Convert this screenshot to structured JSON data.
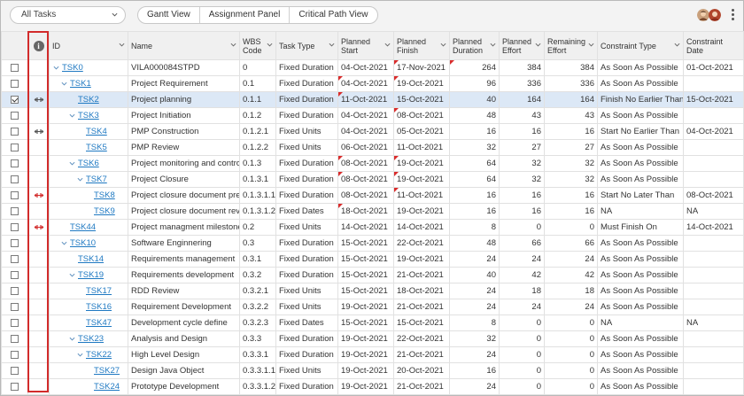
{
  "toolbar": {
    "filter": "All Tasks",
    "views": [
      "Gantt View",
      "Assignment Panel",
      "Critical Path View"
    ],
    "more_icon": "kebab-menu-icon"
  },
  "columns": [
    "ID",
    "Name",
    "WBS Code",
    "Task Type",
    "Planned Start",
    "Planned Finish",
    "Planned Duration",
    "Planned Effort",
    "Remaining Effort",
    "Constraint Type",
    "Constraint Date"
  ],
  "column_lines": {
    "wbs": [
      "WBS",
      "Code"
    ],
    "start": [
      "Planned",
      "Start"
    ],
    "finish": [
      "Planned",
      "Finish"
    ],
    "duration": [
      "Planned",
      "Duration"
    ],
    "effort": [
      "Planned",
      "Effort"
    ],
    "remaining": [
      "Remaining",
      "Effort"
    ],
    "cdate": [
      "Constraint",
      "Date"
    ]
  },
  "rows": [
    {
      "id": "TSK0",
      "name": "VILA000084STPD",
      "wbs": "0",
      "type": "Fixed Duration",
      "start": "04-Oct-2021",
      "finish": "17-Nov-2021",
      "duration": "264",
      "effort": "384",
      "remaining": "384",
      "ctype": "As Soon As Possible",
      "cdate": "01-Oct-2021",
      "level": 0,
      "expand": true,
      "indicator": "",
      "selected": false
    },
    {
      "id": "TSK1",
      "name": "Project Requirement",
      "wbs": "0.1",
      "type": "Fixed Duration",
      "start": "04-Oct-2021",
      "finish": "19-Oct-2021",
      "duration": "96",
      "effort": "336",
      "remaining": "336",
      "ctype": "As Soon As Possible",
      "cdate": "",
      "level": 1,
      "expand": true,
      "indicator": "",
      "selected": false
    },
    {
      "id": "TSK2",
      "name": "Project planning",
      "wbs": "0.1.1",
      "type": "Fixed Duration",
      "start": "11-Oct-2021",
      "finish": "15-Oct-2021",
      "duration": "40",
      "effort": "164",
      "remaining": "164",
      "ctype": "Finish No Earlier Than",
      "cdate": "15-Oct-2021",
      "level": 2,
      "expand": false,
      "indicator": "constraint-icon",
      "selected": true
    },
    {
      "id": "TSK3",
      "name": "Project Initiation",
      "wbs": "0.1.2",
      "type": "Fixed Duration",
      "start": "04-Oct-2021",
      "finish": "08-Oct-2021",
      "duration": "48",
      "effort": "43",
      "remaining": "43",
      "ctype": "As Soon As Possible",
      "cdate": "",
      "level": 2,
      "expand": true,
      "indicator": "",
      "selected": false
    },
    {
      "id": "TSK4",
      "name": "PMP Construction",
      "wbs": "0.1.2.1",
      "type": "Fixed Units",
      "start": "04-Oct-2021",
      "finish": "05-Oct-2021",
      "duration": "16",
      "effort": "16",
      "remaining": "16",
      "ctype": "Start No Earlier Than",
      "cdate": "04-Oct-2021",
      "level": 3,
      "expand": false,
      "indicator": "constraint-icon",
      "selected": false
    },
    {
      "id": "TSK5",
      "name": "PMP Review",
      "wbs": "0.1.2.2",
      "type": "Fixed Units",
      "start": "06-Oct-2021",
      "finish": "11-Oct-2021",
      "duration": "32",
      "effort": "27",
      "remaining": "27",
      "ctype": "As Soon As Possible",
      "cdate": "",
      "level": 3,
      "expand": false,
      "indicator": "",
      "selected": false
    },
    {
      "id": "TSK6",
      "name": "Project monitoring and control",
      "wbs": "0.1.3",
      "type": "Fixed Duration",
      "start": "08-Oct-2021",
      "finish": "19-Oct-2021",
      "duration": "64",
      "effort": "32",
      "remaining": "32",
      "ctype": "As Soon As Possible",
      "cdate": "",
      "level": 2,
      "expand": true,
      "indicator": "",
      "selected": false
    },
    {
      "id": "TSK7",
      "name": "Project Closure",
      "wbs": "0.1.3.1",
      "type": "Fixed Duration",
      "start": "08-Oct-2021",
      "finish": "19-Oct-2021",
      "duration": "64",
      "effort": "32",
      "remaining": "32",
      "ctype": "As Soon As Possible",
      "cdate": "",
      "level": 3,
      "expand": true,
      "indicator": "",
      "selected": false
    },
    {
      "id": "TSK8",
      "name": "Project closure document prepa",
      "wbs": "0.1.3.1.1",
      "type": "Fixed Duration",
      "start": "08-Oct-2021",
      "finish": "11-Oct-2021",
      "duration": "16",
      "effort": "16",
      "remaining": "16",
      "ctype": "Start No Later Than",
      "cdate": "08-Oct-2021",
      "level": 4,
      "expand": false,
      "indicator": "constraint-alert-icon",
      "selected": false
    },
    {
      "id": "TSK9",
      "name": "Project closure document reviev",
      "wbs": "0.1.3.1.2",
      "type": "Fixed Dates",
      "start": "18-Oct-2021",
      "finish": "19-Oct-2021",
      "duration": "16",
      "effort": "16",
      "remaining": "16",
      "ctype": "NA",
      "cdate": "NA",
      "level": 4,
      "expand": false,
      "indicator": "",
      "selected": false
    },
    {
      "id": "TSK44",
      "name": "Project managment milestone",
      "wbs": "0.2",
      "type": "Fixed Units",
      "start": "14-Oct-2021",
      "finish": "14-Oct-2021",
      "duration": "8",
      "effort": "0",
      "remaining": "0",
      "ctype": "Must Finish On",
      "cdate": "14-Oct-2021",
      "level": 1,
      "expand": false,
      "indicator": "constraint-alert-icon",
      "selected": false
    },
    {
      "id": "TSK10",
      "name": "Software Enginnering",
      "wbs": "0.3",
      "type": "Fixed Duration",
      "start": "15-Oct-2021",
      "finish": "22-Oct-2021",
      "duration": "48",
      "effort": "66",
      "remaining": "66",
      "ctype": "As Soon As Possible",
      "cdate": "",
      "level": 1,
      "expand": true,
      "indicator": "",
      "selected": false
    },
    {
      "id": "TSK14",
      "name": "Requirements management",
      "wbs": "0.3.1",
      "type": "Fixed Duration",
      "start": "15-Oct-2021",
      "finish": "19-Oct-2021",
      "duration": "24",
      "effort": "24",
      "remaining": "24",
      "ctype": "As Soon As Possible",
      "cdate": "",
      "level": 2,
      "expand": false,
      "indicator": "",
      "selected": false
    },
    {
      "id": "TSK19",
      "name": "Requirements development",
      "wbs": "0.3.2",
      "type": "Fixed Duration",
      "start": "15-Oct-2021",
      "finish": "21-Oct-2021",
      "duration": "40",
      "effort": "42",
      "remaining": "42",
      "ctype": "As Soon As Possible",
      "cdate": "",
      "level": 2,
      "expand": true,
      "indicator": "",
      "selected": false
    },
    {
      "id": "TSK17",
      "name": "RDD Review",
      "wbs": "0.3.2.1",
      "type": "Fixed Units",
      "start": "15-Oct-2021",
      "finish": "18-Oct-2021",
      "duration": "24",
      "effort": "18",
      "remaining": "18",
      "ctype": "As Soon As Possible",
      "cdate": "",
      "level": 3,
      "expand": false,
      "indicator": "",
      "selected": false
    },
    {
      "id": "TSK16",
      "name": "Requirement Development",
      "wbs": "0.3.2.2",
      "type": "Fixed Units",
      "start": "19-Oct-2021",
      "finish": "21-Oct-2021",
      "duration": "24",
      "effort": "24",
      "remaining": "24",
      "ctype": "As Soon As Possible",
      "cdate": "",
      "level": 3,
      "expand": false,
      "indicator": "",
      "selected": false
    },
    {
      "id": "TSK47",
      "name": "Development cycle define",
      "wbs": "0.3.2.3",
      "type": "Fixed Dates",
      "start": "15-Oct-2021",
      "finish": "15-Oct-2021",
      "duration": "8",
      "effort": "0",
      "remaining": "0",
      "ctype": "NA",
      "cdate": "NA",
      "level": 3,
      "expand": false,
      "indicator": "",
      "selected": false
    },
    {
      "id": "TSK23",
      "name": "Analysis and Design",
      "wbs": "0.3.3",
      "type": "Fixed Duration",
      "start": "19-Oct-2021",
      "finish": "22-Oct-2021",
      "duration": "32",
      "effort": "0",
      "remaining": "0",
      "ctype": "As Soon As Possible",
      "cdate": "",
      "level": 2,
      "expand": true,
      "indicator": "",
      "selected": false
    },
    {
      "id": "TSK22",
      "name": "High Level Design",
      "wbs": "0.3.3.1",
      "type": "Fixed Duration",
      "start": "19-Oct-2021",
      "finish": "21-Oct-2021",
      "duration": "24",
      "effort": "0",
      "remaining": "0",
      "ctype": "As Soon As Possible",
      "cdate": "",
      "level": 3,
      "expand": true,
      "indicator": "",
      "selected": false
    },
    {
      "id": "TSK27",
      "name": "Design Java Object",
      "wbs": "0.3.3.1.1",
      "type": "Fixed Units",
      "start": "19-Oct-2021",
      "finish": "20-Oct-2021",
      "duration": "16",
      "effort": "0",
      "remaining": "0",
      "ctype": "As Soon As Possible",
      "cdate": "",
      "level": 4,
      "expand": false,
      "indicator": "",
      "selected": false
    },
    {
      "id": "TSK24",
      "name": "Prototype Development",
      "wbs": "0.3.3.1.2",
      "type": "Fixed Duration",
      "start": "19-Oct-2021",
      "finish": "21-Oct-2021",
      "duration": "24",
      "effort": "0",
      "remaining": "0",
      "ctype": "As Soon As Possible",
      "cdate": "",
      "level": 4,
      "expand": false,
      "indicator": "",
      "selected": false
    }
  ]
}
